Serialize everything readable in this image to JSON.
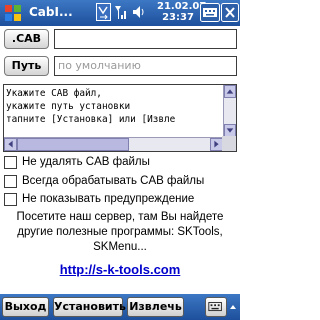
{
  "titlebar": {
    "app_title": "CabI...",
    "time": "21.02.07",
    "clock": "23:37",
    "ok_label": "ok",
    "close_label": "✕",
    "colors": {
      "bar": "#2a62b0",
      "text": "#ffffff"
    }
  },
  "form": {
    "cab_button": ".CAB",
    "cab_value": "",
    "path_button": "Путь",
    "path_placeholder": "по умолчанию"
  },
  "info_lines": [
    "Укажите CAB файл,",
    "укажите путь установки",
    "тапните [Установка] или [Извле"
  ],
  "options": [
    {
      "label": "Не удалять CAB файлы",
      "checked": false
    },
    {
      "label": "Всегда обрабатывать CAB файлы",
      "checked": false
    },
    {
      "label": "Не показывать предупреждение",
      "checked": false
    }
  ],
  "promo_lines": [
    "Посетите наш сервер, там Вы найдете",
    "другие полезные программы: SKTools,",
    "SKMenu..."
  ],
  "link": "http://s-k-tools.com",
  "menu": {
    "exit": "Выход",
    "install": "Установить",
    "extract": "Извлечь"
  }
}
